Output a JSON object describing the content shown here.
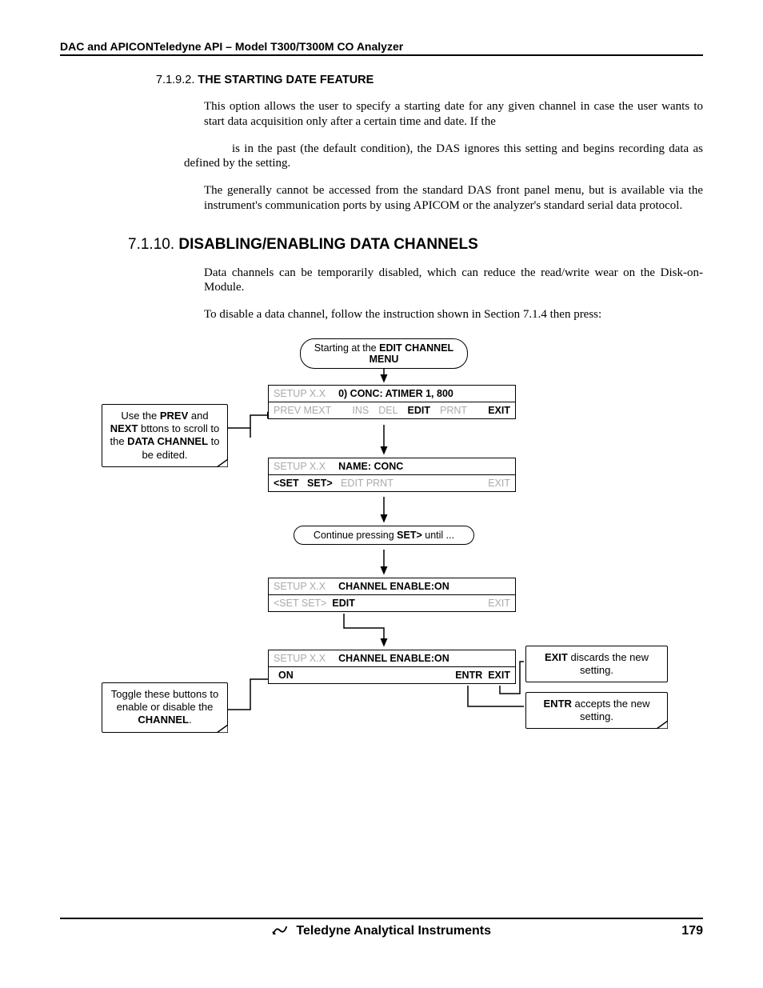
{
  "header": "DAC and APICONTeledyne API – Model T300/T300M CO Analyzer",
  "sec1_num": "7.1.9.2. ",
  "sec1_title": "THE STARTING DATE FEATURE",
  "para1": "This option allows the user to specify a starting date for any given channel in case the user wants to start data acquisition only after a certain time and date.  If the",
  "para1b": "is in the past (the default condition), the DAS ignores this setting and begins recording data as defined by the                                       setting.",
  "para2": "The                                   generally cannot be accessed from the standard DAS front panel menu, but is available via the instrument's communication ports by using APICOM or the analyzer's standard serial data protocol.",
  "sec2_num": "7.1.10. ",
  "sec2_title": "DISABLING/ENABLING DATA CHANNELS",
  "para3": "Data channels can be temporarily disabled, which can reduce the read/write wear on the Disk-on-Module.",
  "para4": "To disable a data channel, follow the instruction shown in Section 7.1.4 then press:",
  "flow": {
    "start_pre": "Starting at the ",
    "start_bold": "EDIT CHANNEL MENU",
    "m1_setup": "SETUP X.X",
    "m1_line": "0) CONC:  ATIMER 1, 800",
    "m1_buttons_left": "PREV MEXT",
    "m1_ins": "INS",
    "m1_del": "DEL",
    "m1_edit": "EDIT",
    "m1_prnt": "PRNT",
    "m1_exit": "EXIT",
    "callout_left_top1": "Use the ",
    "callout_left_top1b": "PREV",
    "callout_left_top1c": " and ",
    "callout_left_top2a": "NEXT",
    "callout_left_top2b": " bttons to scroll to the ",
    "callout_left_top3a": "DATA CHANNEL",
    "callout_left_top3b": " to be edited.",
    "m2_setup": "SETUP X.X",
    "m2_line": "NAME: CONC",
    "m2_buttons_l1": "<SET",
    "m2_buttons_l2": "SET>",
    "m2_buttons_mid": "EDIT  PRNT",
    "m2_buttons_r": "EXIT",
    "cont_pre": "Continue pressing ",
    "cont_bold": "SET>",
    "cont_post": " until ...",
    "m3_setup": "SETUP X.X",
    "m3_line": "CHANNEL ENABLE:ON",
    "m3_buttons_l": "<SET   SET>",
    "m3_buttons_edit": "EDIT",
    "m3_buttons_r": "EXIT",
    "m4_setup": "SETUP X.X",
    "m4_line": "CHANNEL ENABLE:ON",
    "m4_on": "ON",
    "m4_entr": "ENTR",
    "m4_exit": "EXIT",
    "callout_left_bot1": "Toggle these buttons to enable or disable the ",
    "callout_left_bot2": "CHANNEL",
    "callout_left_bot3": ".",
    "callout_right1a": "EXIT",
    "callout_right1b": " discards the new setting.",
    "callout_right2a": "ENTR",
    "callout_right2b": " accepts the new setting."
  },
  "footer_text": "Teledyne Analytical Instruments",
  "page_number": "179"
}
